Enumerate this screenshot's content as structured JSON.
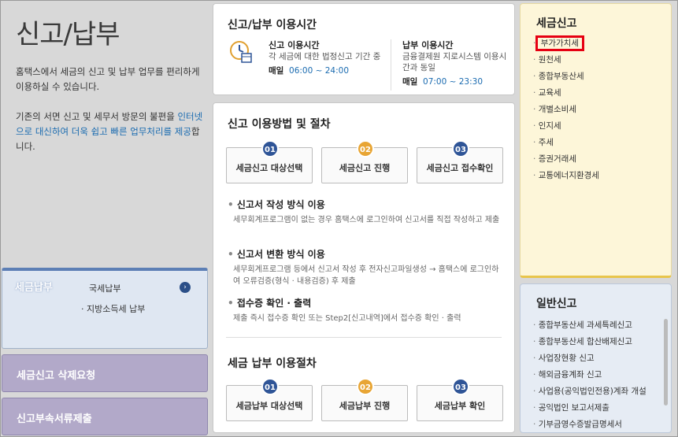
{
  "left": {
    "title": "신고/납부",
    "intro": "홈택스에서 세금의 신고 및 납부 업무를 편리하게 이용하실 수 있습니다.",
    "intro2_pre": "기존의 서면 신고 및 세무서 방문의 불편을 ",
    "intro2_link": "인터넷으로 대신하여 더욱 쉽고 빠른 업무처리를 제공",
    "intro2_post": "합니다.",
    "pay_panel": {
      "header": "세금납부",
      "item1": "국세납부",
      "item2": "· 지방소득세 납부"
    },
    "panel2": "세금신고 삭제요청",
    "panel3": "신고부속서류제출"
  },
  "hours": {
    "title": "신고/납부 이용시간",
    "filing_title": "신고 이용시간",
    "filing_desc": "각 세금에 대한 법정신고 기간 중",
    "filing_daily": "매일",
    "filing_time": "06:00 ~ 24:00",
    "pay_title": "납부 이용시간",
    "pay_desc": "금융결제원 지로시스템 이용시간과 동일",
    "pay_daily": "매일",
    "pay_time": "07:00 ~ 23:30"
  },
  "process": {
    "title": "신고 이용방법 및 절차",
    "steps": [
      {
        "num": "01",
        "label": "세금신고 대상선택"
      },
      {
        "num": "02",
        "label": "세금신고 진행"
      },
      {
        "num": "03",
        "label": "세금신고 접수확인"
      }
    ],
    "methods": [
      {
        "title": "신고서 작성 방식 이용",
        "desc": "세무회계프로그램이 없는 경우 홈택스에 로그인하여 신고서를 직접 작성하고 제출"
      },
      {
        "title": "신고서 변환 방식 이용",
        "desc": "세무회계프로그램 등에서 신고서 작성 후 전자신고파일생성 → 홈택스에 로그인하여 오류검증(형식 · 내용검증) 후 제출"
      },
      {
        "title": "접수증 확인 · 출력",
        "desc": "제출 즉시 접수증 확인 또는 Step2[신고내역]에서 접수증 확인 · 출력"
      }
    ],
    "pay_title": "세금 납부 이용절차",
    "pay_steps": [
      {
        "num": "01",
        "label": "세금납부 대상선택"
      },
      {
        "num": "02",
        "label": "세금납부 진행"
      },
      {
        "num": "03",
        "label": "세금납부 확인"
      }
    ]
  },
  "tax_filing": {
    "title": "세금신고",
    "items": [
      "부가가치세",
      "원천세",
      "종합부동산세",
      "교육세",
      "개별소비세",
      "인지세",
      "주세",
      "증권거래세",
      "교통에너지환경세"
    ]
  },
  "general_filing": {
    "title": "일반신고",
    "items": [
      "종합부동산세 과세특례신고",
      "종합부동산세 합산배제신고",
      "사업장현황 신고",
      "해외금융계좌 신고",
      "사업용(공익법인전용)계좌 개설",
      "공익법인 보고서제출",
      "기부금영수증발급명세서"
    ]
  },
  "colors": {
    "accent_blue": "#2f5597",
    "accent_orange": "#e8a534",
    "highlight_red": "#e60012",
    "link": "#1a6bb0"
  }
}
